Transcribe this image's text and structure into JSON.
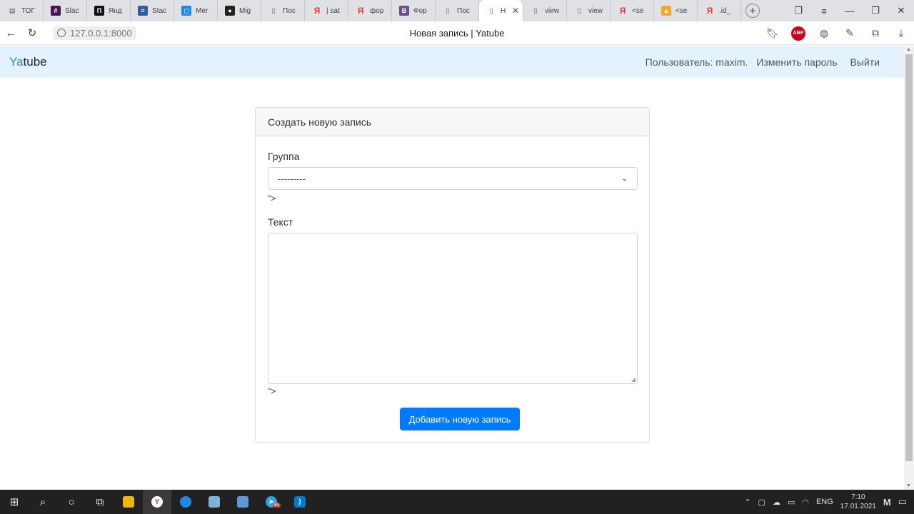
{
  "browser": {
    "tabs": [
      {
        "label": "ТОГ",
        "icon": "document-icon",
        "color": "#5f6368"
      },
      {
        "label": "Slac",
        "icon": "slack-icon",
        "color": "#4a154b"
      },
      {
        "label": "Янд",
        "icon": "yandex-square-icon",
        "color": "#111111"
      },
      {
        "label": "Stac",
        "icon": "stackoverflow-icon",
        "color": "#2f5f9e"
      },
      {
        "label": "Mer",
        "icon": "chat-icon",
        "color": "#1e88e5"
      },
      {
        "label": "Mig",
        "icon": "github-icon",
        "color": "#222222"
      },
      {
        "label": "Пос",
        "icon": "page-icon",
        "color": "#5f6368"
      },
      {
        "label": "| sat",
        "icon": "yandex-icon",
        "color": "#e53935"
      },
      {
        "label": "фор",
        "icon": "yandex-icon",
        "color": "#e53935"
      },
      {
        "label": "Фор",
        "icon": "vk-b-icon",
        "color": "#6a4c93"
      },
      {
        "label": "Пос",
        "icon": "page-icon",
        "color": "#5f6368"
      },
      {
        "label": "Н",
        "icon": "page-icon",
        "color": "#5f6368",
        "active": true
      },
      {
        "label": "view",
        "icon": "page-icon",
        "color": "#5f6368"
      },
      {
        "label": "view",
        "icon": "page-icon",
        "color": "#5f6368"
      },
      {
        "label": "<se",
        "icon": "yandex-icon",
        "color": "#e53935"
      },
      {
        "label": "<se",
        "icon": "image-icon",
        "color": "#f9a825"
      },
      {
        "label": ".id_",
        "icon": "yandex-icon",
        "color": "#e53935"
      }
    ],
    "url": "127.0.0.1:8000",
    "page_title": "Новая запись | Yatube",
    "abp_label": "ABP"
  },
  "site": {
    "brand_prefix": "Ya",
    "brand_suffix": "tube",
    "user_label": "Пользователь: maxim.",
    "change_password": "Изменить пароль",
    "logout": "Выйти"
  },
  "form": {
    "header": "Создать новую запись",
    "group_label": "Группа",
    "group_selected": "---------",
    "residue1": "\">",
    "text_label": "Текст",
    "text_value": "",
    "residue2": "\">",
    "submit_label": "Добавить новую запись"
  },
  "taskbar": {
    "lang": "ENG",
    "time": "7:10",
    "date": "17.01.2021",
    "telegram_badge": "65"
  }
}
